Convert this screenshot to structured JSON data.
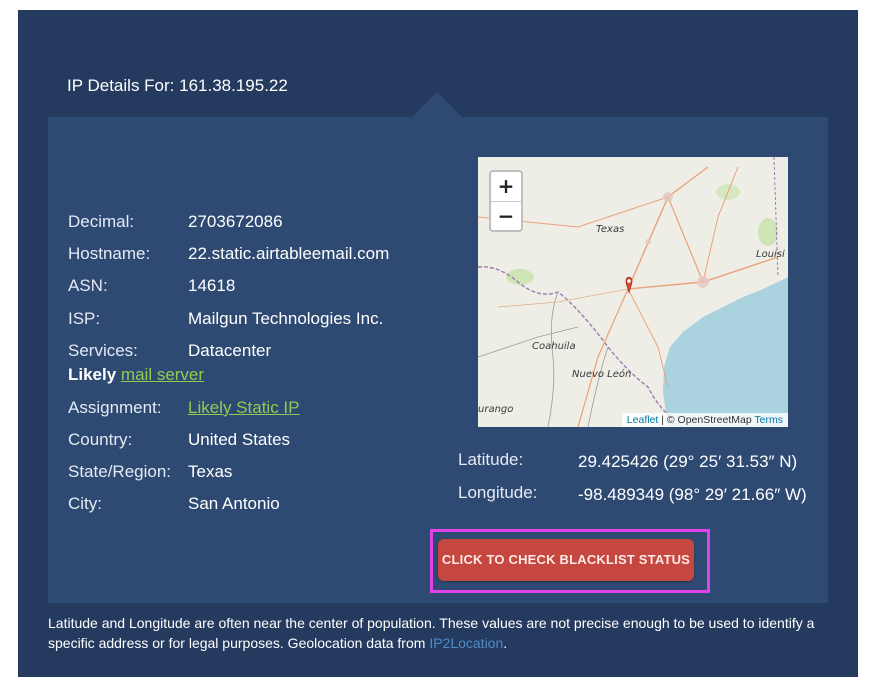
{
  "header": {
    "title": "IP Details For: 161.38.195.22"
  },
  "details": [
    {
      "label": "Decimal:",
      "value": "2703672086"
    },
    {
      "label": "Hostname:",
      "value": "22.static.airtableemail.com"
    },
    {
      "label": "ASN:",
      "value": "14618"
    },
    {
      "label": "ISP:",
      "value": "Mailgun Technologies Inc."
    },
    {
      "label": "Services:",
      "value": "Datacenter"
    }
  ],
  "likely": {
    "prefix": "Likely ",
    "link": "mail server"
  },
  "details2": [
    {
      "label": "Assignment:",
      "value": "Likely Static IP"
    },
    {
      "label": "Country:",
      "value": "United States"
    },
    {
      "label": "State/Region:",
      "value": "Texas"
    },
    {
      "label": "City:",
      "value": "San Antonio"
    }
  ],
  "map": {
    "zoom_in": "+",
    "zoom_out": "−",
    "labels": [
      "Texas",
      "Louisi",
      "Coahuila",
      "Nuevo León",
      "urango"
    ],
    "attribution": {
      "leaflet": "Leaflet",
      "sep": " | © OpenStreetMap ",
      "terms": "Terms"
    }
  },
  "coords": {
    "latitude_label": "Latitude:",
    "latitude_value": "29.425426  (29° 25′ 31.53″ N)",
    "longitude_label": "Longitude:",
    "longitude_value": "-98.489349  (98° 29′ 21.66″ W)"
  },
  "button": {
    "label": "CLICK TO CHECK BLACKLIST STATUS"
  },
  "footnote": {
    "text": "Latitude and Longitude are often near the center of population. These values are not precise enough to be used to identify a specific address or for legal purposes. Geolocation data from ",
    "source": "IP2Location",
    "end": "."
  },
  "colors": {
    "outer_bg": "#243a5e",
    "panel_bg": "#2e4a72",
    "link": "#8fcc52",
    "button": "#c6473f",
    "highlight": "#e044e8"
  }
}
